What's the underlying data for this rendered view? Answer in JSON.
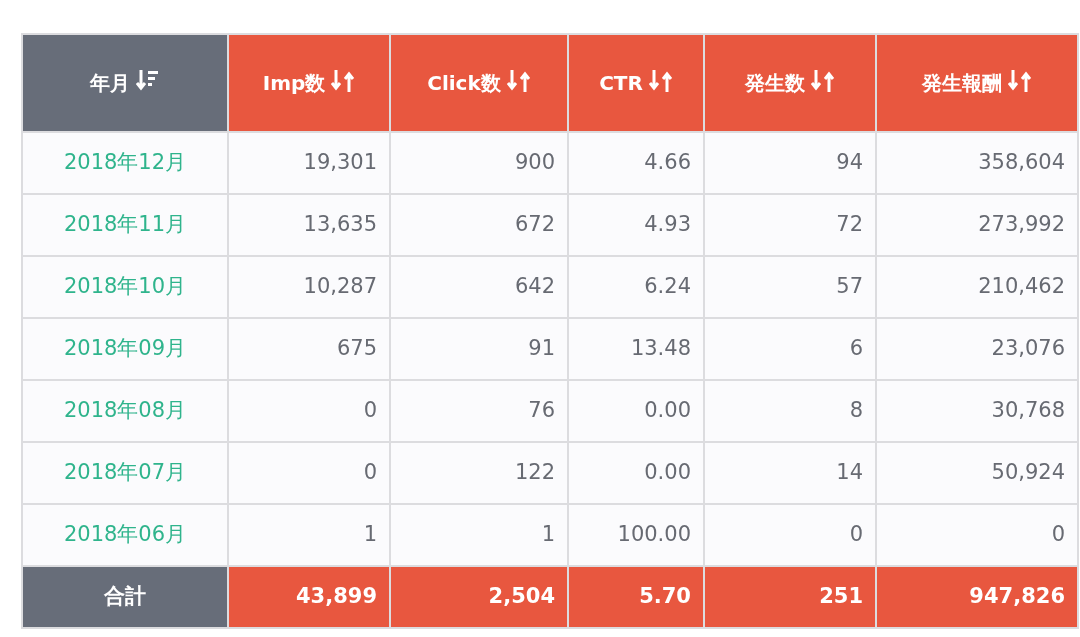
{
  "table": {
    "columns": [
      {
        "label": "年月",
        "sorted": true
      },
      {
        "label": "Imp数",
        "sorted": false
      },
      {
        "label": "Click数",
        "sorted": false
      },
      {
        "label": "CTR",
        "sorted": false
      },
      {
        "label": "発生数",
        "sorted": false
      },
      {
        "label": "発生報酬",
        "sorted": false
      }
    ],
    "rows": [
      {
        "cells": [
          "2018年12月",
          "19,301",
          "900",
          "4.66",
          "94",
          "358,604"
        ]
      },
      {
        "cells": [
          "2018年11月",
          "13,635",
          "672",
          "4.93",
          "72",
          "273,992"
        ]
      },
      {
        "cells": [
          "2018年10月",
          "10,287",
          "642",
          "6.24",
          "57",
          "210,462"
        ]
      },
      {
        "cells": [
          "2018年09月",
          "675",
          "91",
          "13.48",
          "6",
          "23,076"
        ]
      },
      {
        "cells": [
          "2018年08月",
          "0",
          "76",
          "0.00",
          "8",
          "30,768"
        ]
      },
      {
        "cells": [
          "2018年07月",
          "0",
          "122",
          "0.00",
          "14",
          "50,924"
        ]
      },
      {
        "cells": [
          "2018年06月",
          "1",
          "1",
          "100.00",
          "0",
          "0"
        ]
      }
    ],
    "total": {
      "cells": [
        "合計",
        "43,899",
        "2,504",
        "5.70",
        "251",
        "947,826"
      ]
    }
  }
}
